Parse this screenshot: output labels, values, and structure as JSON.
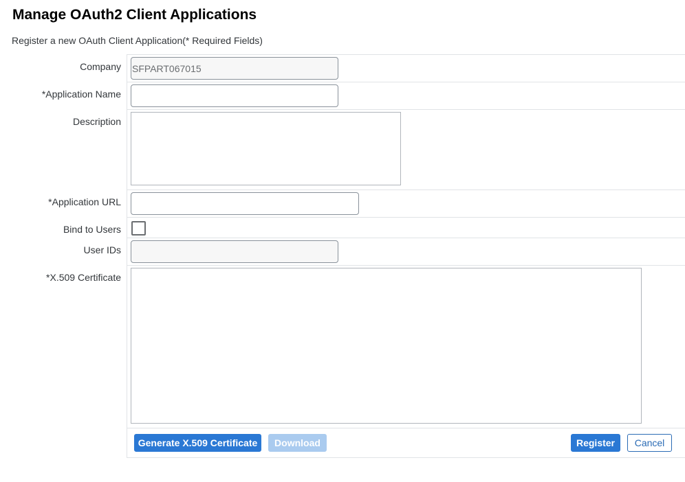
{
  "header": {
    "title": "Manage OAuth2 Client Applications",
    "subtitle": "Register a new OAuth Client Application(* Required Fields)"
  },
  "form": {
    "company_label": "Company",
    "company_value": "SFPART067015",
    "app_name_label": "*Application Name",
    "app_name_value": "",
    "description_label": "Description",
    "description_value": "",
    "app_url_label": "*Application URL",
    "app_url_value": "",
    "bind_users_label": "Bind to Users",
    "bind_users_checked": false,
    "user_ids_label": "User IDs",
    "user_ids_value": "",
    "certificate_label": "*X.509 Certificate",
    "certificate_value": ""
  },
  "actions": {
    "generate_label": "Generate X.509 Certificate",
    "download_label": "Download",
    "register_label": "Register",
    "cancel_label": "Cancel"
  },
  "colors": {
    "primary": "#2a78d4",
    "disabled": "#aacbef",
    "border": "#e0e3e6"
  }
}
